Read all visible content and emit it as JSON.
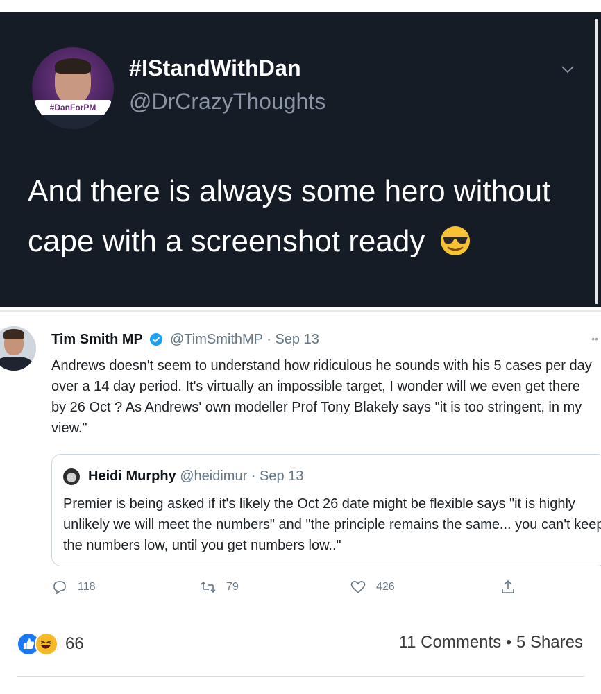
{
  "dark_tweet": {
    "display_name": "#IStandWithDan",
    "handle": "@DrCrazyThoughts",
    "avatar_tag": "#DanForPM",
    "text": "And there is always some hero without cape with a screenshot ready",
    "emoji": "sunglasses-emoji"
  },
  "embedded_tweet": {
    "name": "Tim Smith MP",
    "handle": "@TimSmithMP",
    "separator": "·",
    "date": "Sep 13",
    "body": "Andrews doesn't seem to understand how ridiculous he sounds with his 5 cases per day over a 14 day period. It's virtually an impossible target, I wonder will we even get there by 26 Oct ? As Andrews' own modeller Prof Tony Blakely says \"it is too stringent, in my view.\"",
    "quote": {
      "name": "Heidi Murphy",
      "handle": "@heidimur",
      "separator": "·",
      "date": "Sep 13",
      "body": "Premier is being asked if it's likely the Oct 26 date might be flexible says \"it is highly unlikely we will meet the numbers\" and \"the principle remains the same... you can't keep the numbers low, until you get numbers low..\""
    },
    "actions": {
      "replies": "118",
      "retweets": "79",
      "likes": "426"
    }
  },
  "facebook_footer": {
    "reaction_count": "66",
    "comments": "11 Comments",
    "dot": "•",
    "shares": "5 Shares"
  },
  "colors": {
    "dark_bg": "#161c26",
    "twitter_blue": "#1da1f2",
    "fb_blue": "#1877f2"
  }
}
